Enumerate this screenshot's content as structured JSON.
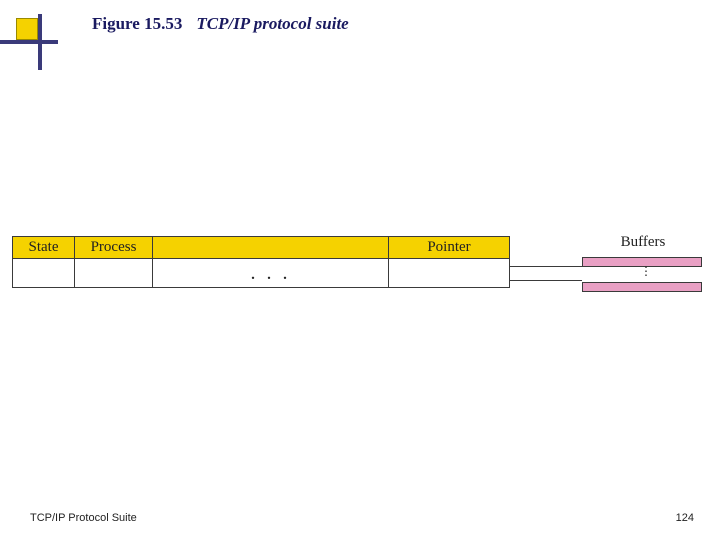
{
  "figure": {
    "label": "Figure 15.53",
    "title": "TCP/IP protocol suite"
  },
  "table": {
    "headers": {
      "state": "State",
      "process": "Process",
      "gap": "",
      "pointer": "Pointer"
    },
    "gap_body": ". . ."
  },
  "buffers": {
    "label": "Buffers",
    "vdots": "⋮"
  },
  "footer": {
    "left": "TCP/IP Protocol Suite",
    "page": "124"
  }
}
